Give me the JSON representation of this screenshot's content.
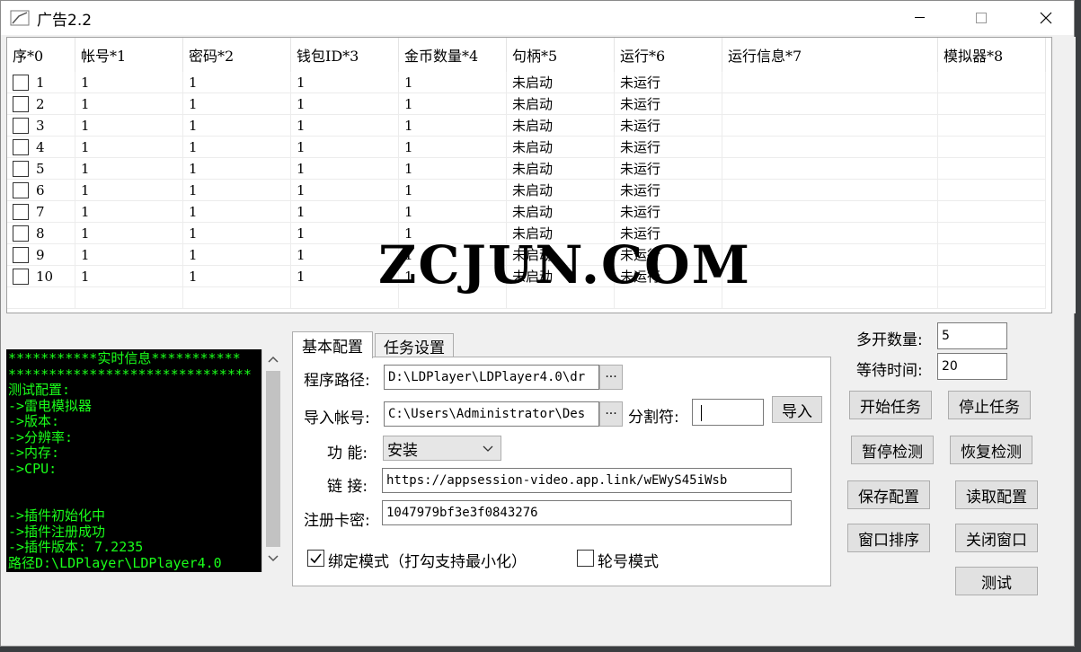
{
  "window": {
    "title": "广告2.2"
  },
  "table": {
    "headers": [
      "序*0",
      "帐号*1",
      "密码*2",
      "钱包ID*3",
      "金币数量*4",
      "句柄*5",
      "运行*6",
      "运行信息*7",
      "模拟器*8"
    ],
    "rows": [
      {
        "no": "1",
        "account": "1",
        "password": "1",
        "wallet": "1",
        "coins": "1",
        "handle": "未启动",
        "run": "未运行",
        "info": "",
        "emu": ""
      },
      {
        "no": "2",
        "account": "1",
        "password": "1",
        "wallet": "1",
        "coins": "1",
        "handle": "未启动",
        "run": "未运行",
        "info": "",
        "emu": ""
      },
      {
        "no": "3",
        "account": "1",
        "password": "1",
        "wallet": "1",
        "coins": "1",
        "handle": "未启动",
        "run": "未运行",
        "info": "",
        "emu": ""
      },
      {
        "no": "4",
        "account": "1",
        "password": "1",
        "wallet": "1",
        "coins": "1",
        "handle": "未启动",
        "run": "未运行",
        "info": "",
        "emu": ""
      },
      {
        "no": "5",
        "account": "1",
        "password": "1",
        "wallet": "1",
        "coins": "1",
        "handle": "未启动",
        "run": "未运行",
        "info": "",
        "emu": ""
      },
      {
        "no": "6",
        "account": "1",
        "password": "1",
        "wallet": "1",
        "coins": "1",
        "handle": "未启动",
        "run": "未运行",
        "info": "",
        "emu": ""
      },
      {
        "no": "7",
        "account": "1",
        "password": "1",
        "wallet": "1",
        "coins": "1",
        "handle": "未启动",
        "run": "未运行",
        "info": "",
        "emu": ""
      },
      {
        "no": "8",
        "account": "1",
        "password": "1",
        "wallet": "1",
        "coins": "1",
        "handle": "未启动",
        "run": "未运行",
        "info": "",
        "emu": ""
      },
      {
        "no": "9",
        "account": "1",
        "password": "1",
        "wallet": "1",
        "coins": "1",
        "handle": "未启动",
        "run": "未运行",
        "info": "",
        "emu": ""
      },
      {
        "no": "10",
        "account": "1",
        "password": "1",
        "wallet": "1",
        "coins": "1",
        "handle": "未启动",
        "run": "未运行",
        "info": "",
        "emu": ""
      }
    ]
  },
  "log": {
    "lines": [
      "***********实时信息***********",
      "******************************",
      "测试配置:",
      "->雷电模拟器",
      "->版本:",
      "->分辨率:",
      "->内存:",
      "->CPU:",
      "",
      "",
      "->插件初始化中",
      "->插件注册成功",
      "->插件版本: 7.2235",
      "路径D:\\LDPlayer\\LDPlayer4.0"
    ]
  },
  "tabs": [
    "基本配置",
    "任务设置"
  ],
  "basic": {
    "program_path_label": "程序路径:",
    "program_path_value": "D:\\LDPlayer\\LDPlayer4.0\\dr",
    "import_account_label": "导入帐号:",
    "import_account_value": "C:\\Users\\Administrator\\Des",
    "separator_label": "分割符:",
    "separator_value": "",
    "import_button": "导入",
    "function_label": "功  能:",
    "function_value": "安装",
    "link_label": "链  接:",
    "link_value": "https://appsession-video.app.link/wEWyS45iWsb",
    "reg_label": "注册卡密:",
    "reg_value": "1047979bf3e3f0843276",
    "bind_mode_label": "绑定模式（打勾支持最小化）",
    "bind_mode_checked": true,
    "rotate_mode_label": "轮号模式",
    "rotate_mode_checked": false,
    "browse": "···"
  },
  "side": {
    "multi_count_label": "多开数量:",
    "multi_count_value": "5",
    "wait_time_label": "等待时间:",
    "wait_time_value": "20",
    "buttons": {
      "start": "开始任务",
      "stop": "停止任务",
      "pause_check": "暂停检测",
      "resume_check": "恢复检测",
      "save_config": "保存配置",
      "load_config": "读取配置",
      "sort_windows": "窗口排序",
      "close_windows": "关闭窗口",
      "test": "测试"
    }
  },
  "watermark": "ZCJUN.COM"
}
